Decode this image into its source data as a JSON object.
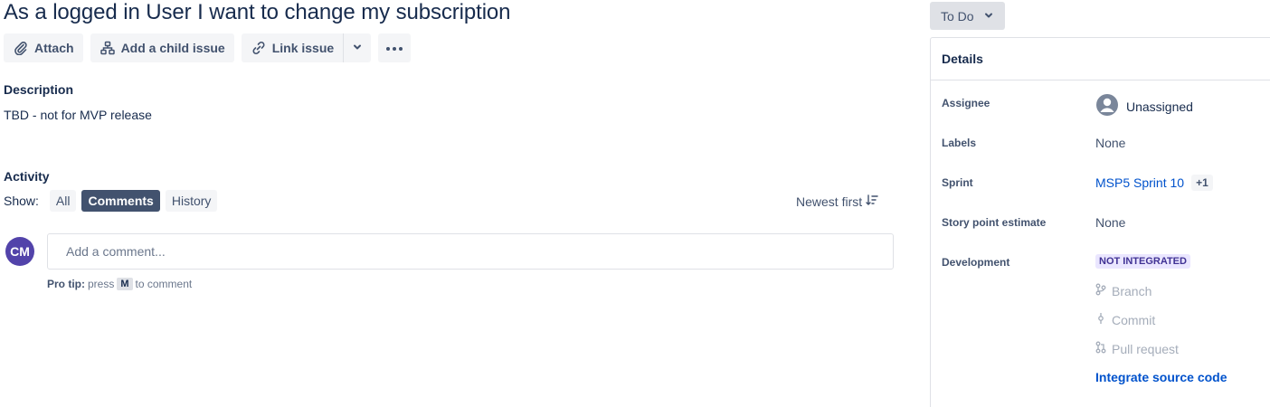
{
  "issue": {
    "title": "As a logged in User I want to change my subscription"
  },
  "toolbar": {
    "attach_label": "Attach",
    "child_label": "Add a child issue",
    "link_label": "Link issue"
  },
  "description": {
    "heading": "Description",
    "text": "TBD - not for MVP release"
  },
  "activity": {
    "heading": "Activity",
    "show_label": "Show:",
    "filters": [
      "All",
      "Comments",
      "History"
    ],
    "active_filter": "Comments",
    "sort_label": "Newest first"
  },
  "comment": {
    "avatar_initials": "CM",
    "placeholder": "Add a comment...",
    "protip_label": "Pro tip:",
    "protip_press": "press",
    "protip_key": "M",
    "protip_suffix": "to comment"
  },
  "status": {
    "label": "To Do"
  },
  "details": {
    "header": "Details",
    "assignee_label": "Assignee",
    "assignee_value": "Unassigned",
    "labels_label": "Labels",
    "labels_value": "None",
    "sprint_label": "Sprint",
    "sprint_value": "MSP5 Sprint 10",
    "sprint_extra": "+1",
    "estimate_label": "Story point estimate",
    "estimate_value": "None",
    "development_label": "Development",
    "development_status": "NOT INTEGRATED",
    "dev_items": [
      "Branch",
      "Commit",
      "Pull request"
    ],
    "integrate_label": "Integrate source code"
  },
  "colors": {
    "accent": "#0052cc",
    "text": "#172b4d",
    "subtle": "#42526e",
    "active_filter_bg": "#42526e",
    "avatar_bg": "#5243aa",
    "lozenge_bg": "#eae6ff",
    "lozenge_text": "#403294"
  },
  "icons": [
    "paperclip-icon",
    "child-issue-icon",
    "link-icon",
    "chevron-down-icon",
    "more-icon",
    "sort-icon",
    "user-avatar-icon",
    "branch-icon",
    "commit-icon",
    "pull-request-icon"
  ]
}
